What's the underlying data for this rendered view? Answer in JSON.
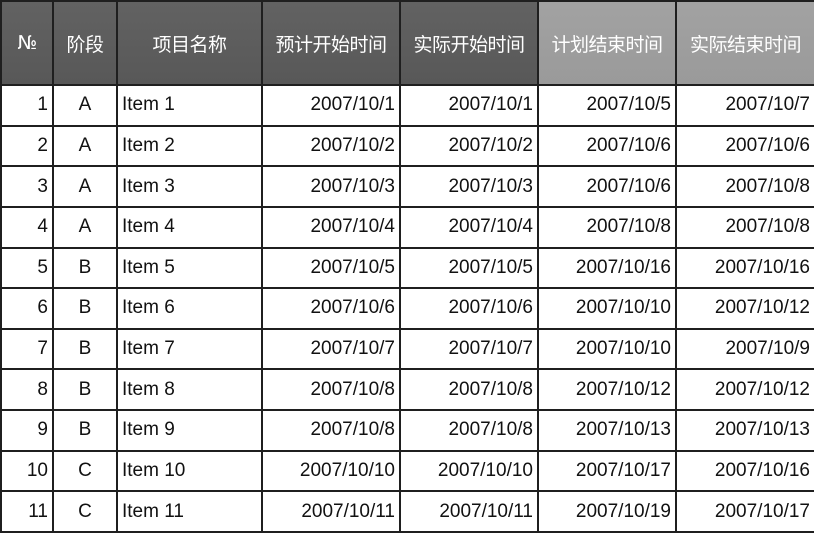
{
  "table": {
    "headers": [
      {
        "label": "№",
        "tone": "dark"
      },
      {
        "label": "阶段",
        "tone": "dark"
      },
      {
        "label": "项目名称",
        "tone": "dark"
      },
      {
        "label": "预计开始时间",
        "tone": "dark"
      },
      {
        "label": "实际开始时间",
        "tone": "dark"
      },
      {
        "label": "计划结束时间",
        "tone": "light"
      },
      {
        "label": "实际结束时间",
        "tone": "light"
      }
    ],
    "header_colors": {
      "dark": "#5c5c5c",
      "light": "#9e9e9e",
      "text": "#ffffff"
    },
    "rows": [
      {
        "no": "1",
        "stage": "A",
        "name": "Item 1",
        "planned_start": "2007/10/1",
        "actual_start": "2007/10/1",
        "planned_end": "2007/10/5",
        "actual_end": "2007/10/7"
      },
      {
        "no": "2",
        "stage": "A",
        "name": "Item 2",
        "planned_start": "2007/10/2",
        "actual_start": "2007/10/2",
        "planned_end": "2007/10/6",
        "actual_end": "2007/10/6"
      },
      {
        "no": "3",
        "stage": "A",
        "name": "Item 3",
        "planned_start": "2007/10/3",
        "actual_start": "2007/10/3",
        "planned_end": "2007/10/6",
        "actual_end": "2007/10/8"
      },
      {
        "no": "4",
        "stage": "A",
        "name": "Item 4",
        "planned_start": "2007/10/4",
        "actual_start": "2007/10/4",
        "planned_end": "2007/10/8",
        "actual_end": "2007/10/8"
      },
      {
        "no": "5",
        "stage": "B",
        "name": "Item 5",
        "planned_start": "2007/10/5",
        "actual_start": "2007/10/5",
        "planned_end": "2007/10/16",
        "actual_end": "2007/10/16"
      },
      {
        "no": "6",
        "stage": "B",
        "name": "Item 6",
        "planned_start": "2007/10/6",
        "actual_start": "2007/10/6",
        "planned_end": "2007/10/10",
        "actual_end": "2007/10/12"
      },
      {
        "no": "7",
        "stage": "B",
        "name": "Item 7",
        "planned_start": "2007/10/7",
        "actual_start": "2007/10/7",
        "planned_end": "2007/10/10",
        "actual_end": "2007/10/9"
      },
      {
        "no": "8",
        "stage": "B",
        "name": "Item 8",
        "planned_start": "2007/10/8",
        "actual_start": "2007/10/8",
        "planned_end": "2007/10/12",
        "actual_end": "2007/10/12"
      },
      {
        "no": "9",
        "stage": "B",
        "name": "Item 9",
        "planned_start": "2007/10/8",
        "actual_start": "2007/10/8",
        "planned_end": "2007/10/13",
        "actual_end": "2007/10/13"
      },
      {
        "no": "10",
        "stage": "C",
        "name": "Item 10",
        "planned_start": "2007/10/10",
        "actual_start": "2007/10/10",
        "planned_end": "2007/10/17",
        "actual_end": "2007/10/16"
      },
      {
        "no": "11",
        "stage": "C",
        "name": "Item 11",
        "planned_start": "2007/10/11",
        "actual_start": "2007/10/11",
        "planned_end": "2007/10/19",
        "actual_end": "2007/10/17"
      }
    ]
  }
}
